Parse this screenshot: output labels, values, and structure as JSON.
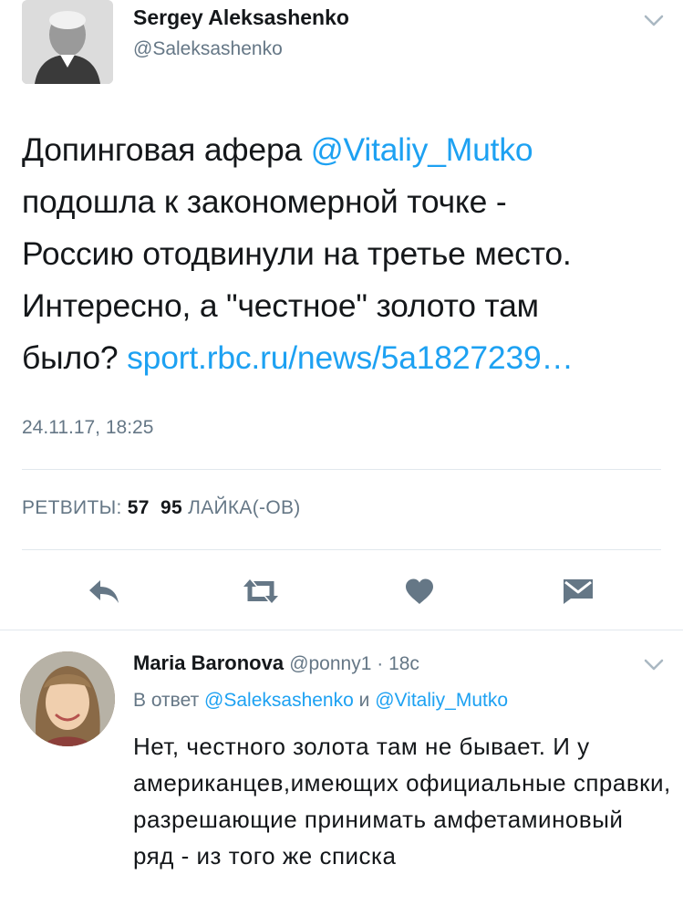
{
  "main_tweet": {
    "author_name": "Sergey Aleksashenko",
    "author_handle": "@Saleksashenko",
    "text_line1_a": "Допинговая афера ",
    "text_line1_mention": "@Vitaliy_Mutko",
    "text_line2": "подошла к закономерной точке -",
    "text_line3": "Россию отодвинули на третье место.",
    "text_line4": "Интересно, а \"честное\" золото там",
    "text_line5_a": "было? ",
    "text_line5_link": "sport.rbc.ru/news/5a1827239…",
    "timestamp": "24.11.17, 18:25",
    "retweets_label": "РЕТВИТЫ:",
    "retweets_count": "57",
    "likes_count": "95",
    "likes_label": "ЛАЙКА(-ОВ)"
  },
  "actions": [
    {
      "icon": "reply-icon"
    },
    {
      "icon": "retweet-icon"
    },
    {
      "icon": "heart-icon"
    },
    {
      "icon": "message-icon"
    }
  ],
  "reply_tweet": {
    "author_name": "Maria Baronova",
    "author_handle": "@ponny1",
    "separator": " · ",
    "time": "18с",
    "in_reply_prefix": "В ответ ",
    "in_reply_user1": "@Saleksashenko",
    "in_reply_and": " и ",
    "in_reply_user2": "@Vitaliy_Mutko",
    "text": "Нет, честного золота там не бывает. И у американцев,имеющих официальные справки, разрешающие принимать амфетаминовый ряд - из того же списка"
  },
  "colors": {
    "link": "#1da1f2",
    "secondary": "#657786",
    "icon": "#657786",
    "divider": "#e1e8ed"
  }
}
